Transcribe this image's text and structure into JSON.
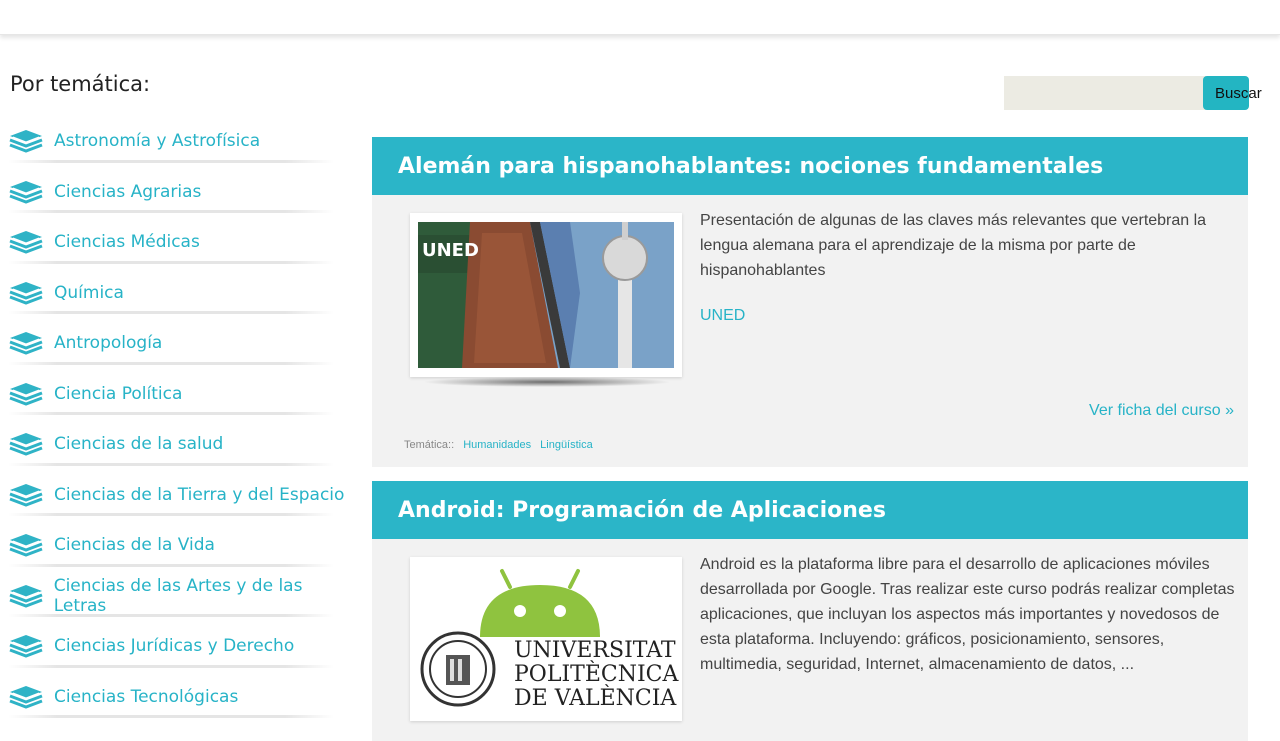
{
  "sidebar": {
    "title": "Por temática:",
    "items": [
      {
        "label": "Astronomía y Astrofísica"
      },
      {
        "label": "Ciencias Agrarias"
      },
      {
        "label": "Ciencias Médicas"
      },
      {
        "label": "Química"
      },
      {
        "label": "Antropología"
      },
      {
        "label": "Ciencia Política"
      },
      {
        "label": "Ciencias de la salud"
      },
      {
        "label": "Ciencias de la Tierra y del Espacio"
      },
      {
        "label": "Ciencias de la Vida"
      },
      {
        "label": "Ciencias de las Artes y de las Letras"
      },
      {
        "label": "Ciencias Jurídicas y Derecho"
      },
      {
        "label": "Ciencias Tecnológicas"
      }
    ],
    "item_icon": "stacked-books-icon"
  },
  "search": {
    "placeholder": "",
    "button_label": "Buscar"
  },
  "courses": [
    {
      "title": "Alemán para hispanohablantes: nociones fundamentales",
      "image_logo": "UNED",
      "description": "Presentación de algunas de las claves más relevantes que vertebran la lengua alemana para el aprendizaje de la misma por parte de hispanohablantes",
      "provider": "UNED",
      "more_label": "Ver ficha del curso »",
      "tags_label": "Temática::",
      "tags": [
        "Humanidades",
        "Lingüística"
      ]
    },
    {
      "title": "Android: Programación de Aplicaciones",
      "image_logo_line1": "UNIVERSITAT",
      "image_logo_line2": "POLITÈCNICA",
      "image_logo_line3": "DE VALÈNCIA",
      "description": "Android es la plataforma libre para el desarrollo de aplicaciones móviles desarrollada por Google. Tras realizar este curso podrás realizar completas aplicaciones, que incluyan los aspectos más importantes y novedosos de esta plataforma. Incluyendo: gráficos, posicionamiento, sensores, multimedia, seguridad, Internet, almacenamiento de datos, ..."
    }
  ],
  "colors": {
    "accent": "#2bb5c8",
    "link": "#27b3c7",
    "card_bg": "#f2f2f2"
  }
}
